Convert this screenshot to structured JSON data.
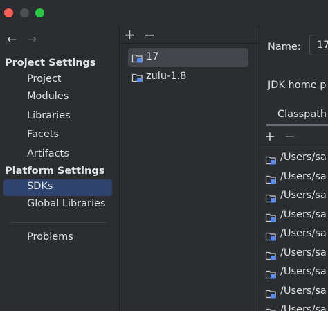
{
  "nav": {
    "back_arrow": "←",
    "forward_arrow": "→",
    "project_settings_header": "Project Settings",
    "project_items": [
      "Project",
      "Modules",
      "Libraries",
      "Facets",
      "Artifacts"
    ],
    "platform_settings_header": "Platform Settings",
    "platform_items": [
      "SDKs",
      "Global Libraries"
    ],
    "selected": "SDKs",
    "problems": "Problems"
  },
  "sdk_list": {
    "add": "+",
    "remove": "−",
    "items": [
      "17",
      "zulu-1.8"
    ],
    "selected": "17"
  },
  "details": {
    "name_label": "Name:",
    "name_value": "17",
    "jdk_home_label": "JDK home p",
    "tab_label": "Classpath",
    "add": "+",
    "remove": "−",
    "paths": [
      "/Users/sa",
      "/Users/sa",
      "/Users/sa",
      "/Users/sa",
      "/Users/sa",
      "/Users/sa",
      "/Users/sa",
      "/Users/sa",
      "/Users/sa"
    ]
  },
  "colors": {
    "background": "#2b2d30",
    "nav_selected": "#2e436e",
    "list_selected": "#43454a",
    "icon_blue": "#548af7"
  }
}
